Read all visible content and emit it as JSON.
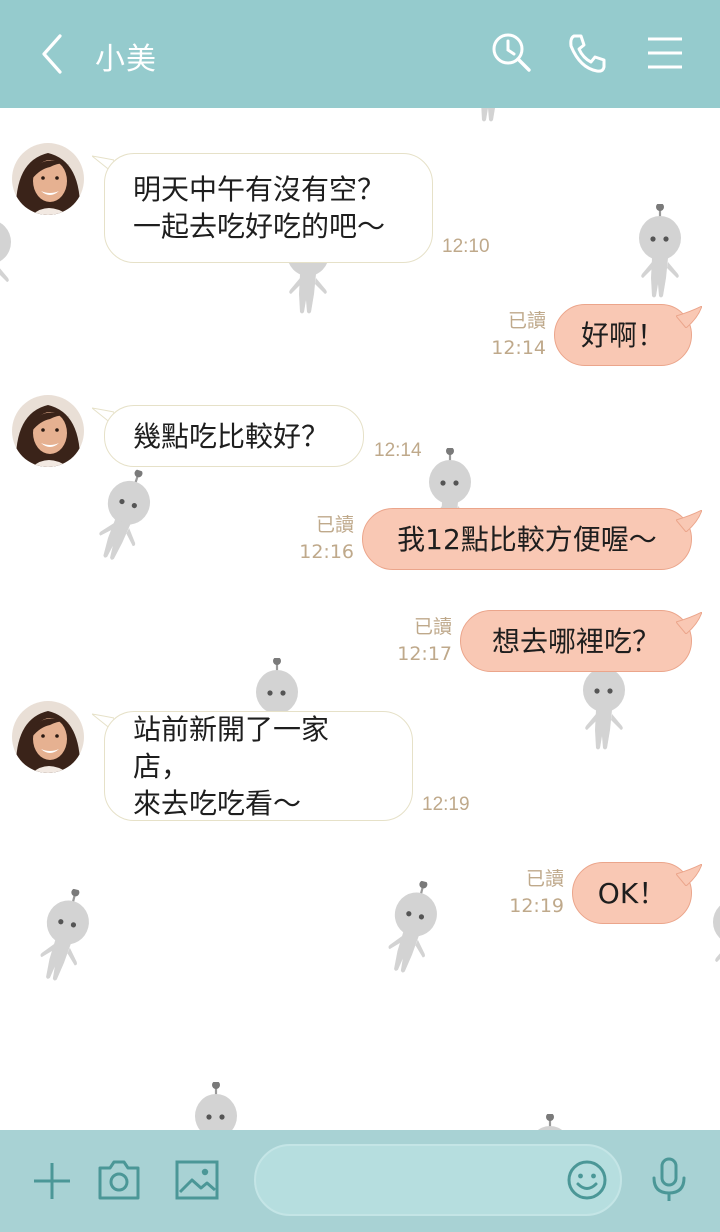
{
  "header": {
    "title": "小美",
    "icons": [
      "back-arrow-icon",
      "clock-search-icon",
      "phone-icon",
      "menu-icon"
    ]
  },
  "contact": {
    "avatar": "avatar-photo"
  },
  "messages": [
    {
      "side": "in",
      "lines": [
        "明天中午有沒有空？",
        "一起去吃好吃的吧～"
      ],
      "time": "12:10"
    },
    {
      "side": "out",
      "lines": [
        "好啊！"
      ],
      "read": "已讀",
      "time": "12:14"
    },
    {
      "side": "in",
      "lines": [
        "幾點吃比較好？"
      ],
      "time": "12:14"
    },
    {
      "side": "out",
      "lines": [
        "我12點比較方便喔～"
      ],
      "read": "已讀",
      "time": "12:16"
    },
    {
      "side": "out",
      "lines": [
        "想去哪裡吃？"
      ],
      "read": "已讀",
      "time": "12:17"
    },
    {
      "side": "in",
      "lines": [
        "站前新開了一家店，",
        "來去吃吃看～"
      ],
      "time": "12:19"
    },
    {
      "side": "out",
      "lines": [
        "OK！"
      ],
      "read": "已讀",
      "time": "12:19"
    }
  ],
  "input_bar": {
    "placeholder": "",
    "icons": [
      "plus-icon",
      "camera-icon",
      "image-icon",
      "emoji-icon",
      "microphone-icon"
    ]
  },
  "colors": {
    "header_bg": "#95cbcd",
    "bottom_bg": "#a8d2d4",
    "out_bubble": "#f9c8b4",
    "in_bubble": "#ffffff",
    "meta_text": "#bfa98b",
    "icon_teal": "#4b9797"
  }
}
